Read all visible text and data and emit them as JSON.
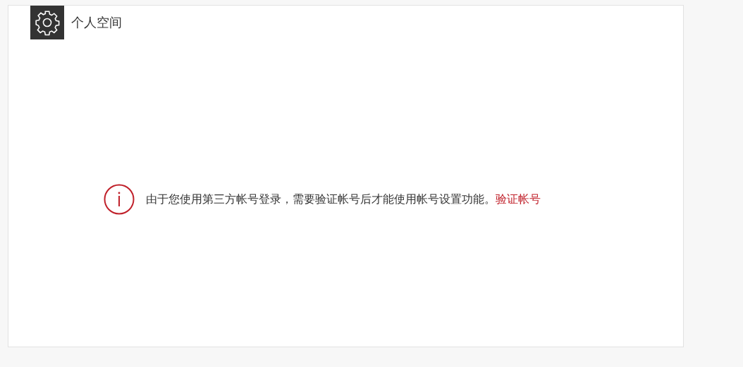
{
  "header": {
    "title": "个人空间"
  },
  "notice": {
    "message": "由于您使用第三方帐号登录，需要验证帐号后才能使用帐号设置功能。",
    "link": "验证帐号"
  }
}
